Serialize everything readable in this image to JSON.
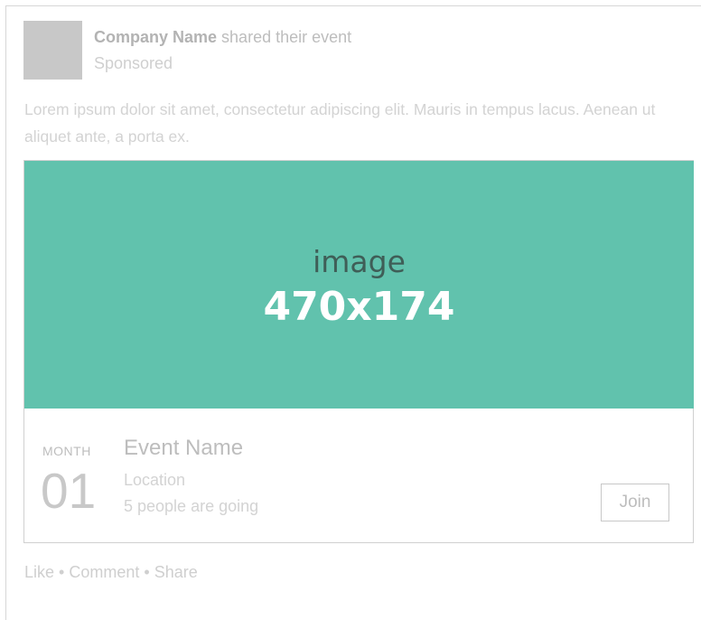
{
  "post": {
    "company_name": "Company Name",
    "shared_text": " shared their event",
    "sponsored": "Sponsored",
    "body_text": "Lorem ipsum dolor sit amet, consectetur adipiscing elit. Mauris in tempus lacus. Aenean ut aliquet ante, a porta ex."
  },
  "image": {
    "word": "image",
    "size": "470x174",
    "color": "#61c2ad"
  },
  "event": {
    "month": "MONTH",
    "day": "01",
    "name": "Event Name",
    "location": "Location",
    "going": "5 people are going",
    "join_label": "Join"
  },
  "actions": {
    "like": "Like",
    "separator": "•",
    "comment": "Comment",
    "share": "Share"
  }
}
